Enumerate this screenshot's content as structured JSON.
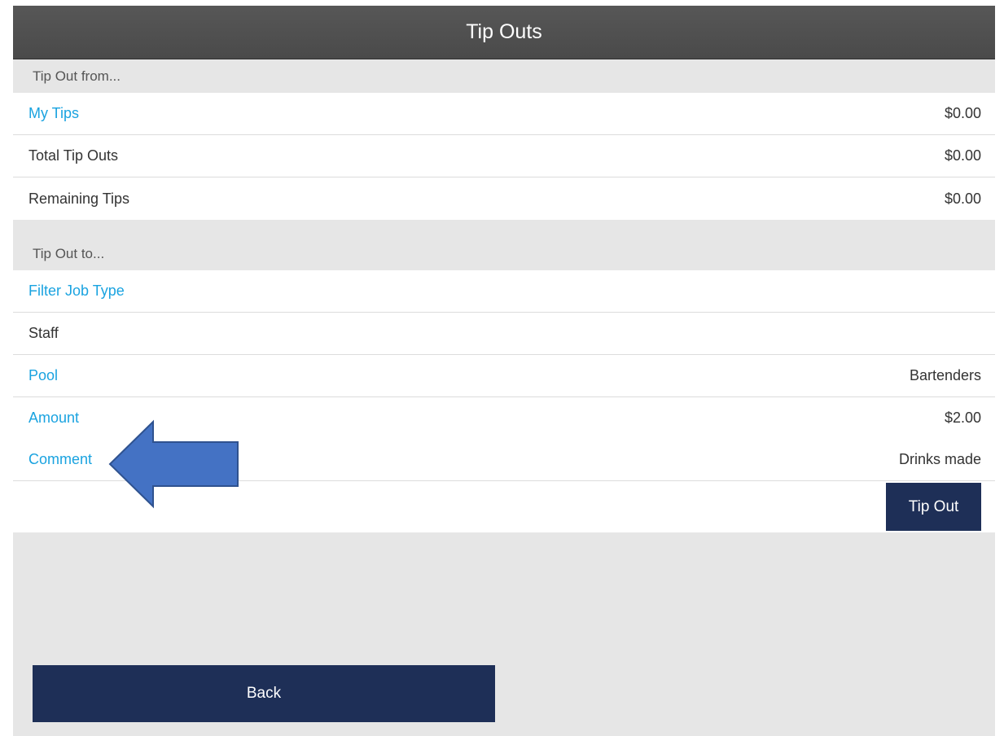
{
  "header": {
    "title": "Tip Outs"
  },
  "tip_out_from": {
    "section_label": "Tip Out from...",
    "rows": [
      {
        "label": "My Tips",
        "value": "$0.00"
      },
      {
        "label": "Total Tip Outs",
        "value": "$0.00"
      },
      {
        "label": "Remaining Tips",
        "value": "$0.00"
      }
    ]
  },
  "tip_out_to": {
    "section_label": "Tip Out to...",
    "rows": [
      {
        "label": "Filter Job Type",
        "value": ""
      },
      {
        "label": "Staff",
        "value": ""
      },
      {
        "label": "Pool",
        "value": "Bartenders"
      },
      {
        "label": "Amount",
        "value": "$2.00"
      },
      {
        "label": "Comment",
        "value": "Drinks made"
      }
    ],
    "tip_out_label": "Tip Out"
  },
  "footer": {
    "back_label": "Back"
  },
  "colors": {
    "link": "#1aa3e0",
    "button": "#1e2f57",
    "annotation_fill": "#4472c4",
    "annotation_stroke": "#2f528f"
  },
  "annotation": {
    "icon": "left-arrow-icon",
    "points_to": "Comment"
  }
}
